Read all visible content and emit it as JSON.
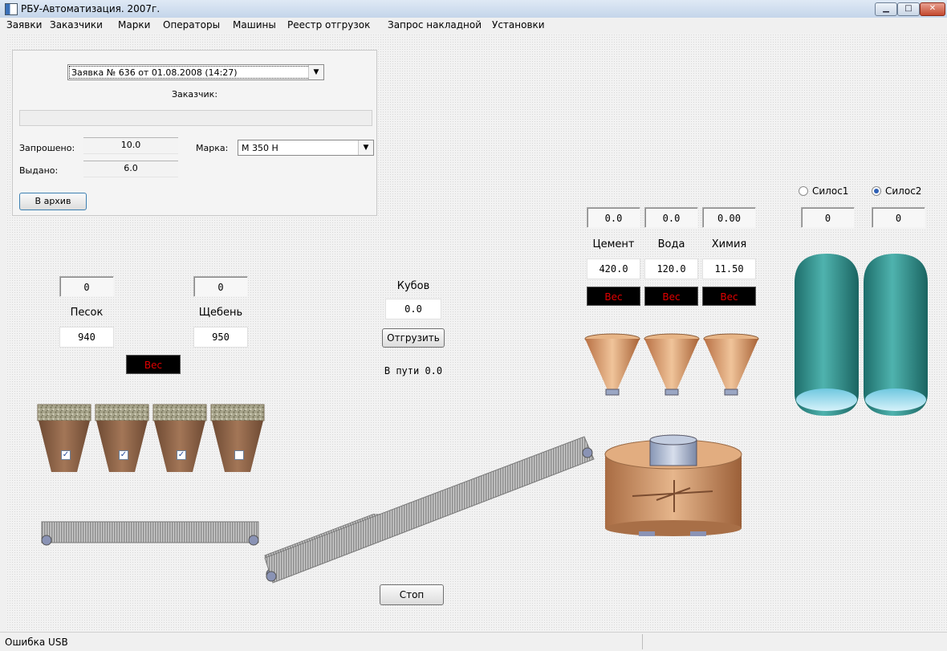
{
  "window": {
    "title": "РБУ-Автоматизация. 2007г."
  },
  "menu": [
    "Заявки",
    "Заказчики",
    "Марки",
    "Операторы",
    "Машины",
    "Реестр отгрузок",
    "Запрос накладной",
    "Установки"
  ],
  "order": {
    "selected": "Заявка № 636 от 01.08.2008 (14:27)",
    "customer_label": "Заказчик:",
    "requested_label": "Запрошено:",
    "requested_value": "10.0",
    "issued_label": "Выдано:",
    "issued_value": "6.0",
    "grade_label": "Марка:",
    "grade_value": "М 350 Н",
    "archive_button": "В архив"
  },
  "aggregates": {
    "sand": {
      "label": "Песок",
      "current": "0",
      "target": "940"
    },
    "gravel": {
      "label": "Щебень",
      "current": "0",
      "target": "950"
    },
    "weight_label": "Вес",
    "bins_checked": [
      true,
      true,
      true,
      false
    ]
  },
  "shipment": {
    "cubes_label": "Кубов",
    "cubes_value": "0.0",
    "ship_button": "Отгрузить",
    "in_transit": "В пути 0.0",
    "stop_button": "Стоп"
  },
  "dosing": {
    "cement": {
      "label": "Цемент",
      "current": "0.0",
      "target": "420.0"
    },
    "water": {
      "label": "Вода",
      "current": "0.0",
      "target": "120.0"
    },
    "chem": {
      "label": "Химия",
      "current": "0.00",
      "target": "11.50"
    },
    "weight_label": "Вес"
  },
  "silos": {
    "silo1": {
      "label": "Силос1",
      "value": "0",
      "selected": false
    },
    "silo2": {
      "label": "Силос2",
      "value": "0",
      "selected": true
    }
  },
  "status": {
    "text": "Ошибка USB"
  },
  "colors": {
    "silo": "#2f8f8c",
    "hopper": "#c98a5a",
    "bin": "#8e6447",
    "belt": "#9a9a9a",
    "weight_bg": "#000000",
    "weight_text": "#e20000"
  }
}
